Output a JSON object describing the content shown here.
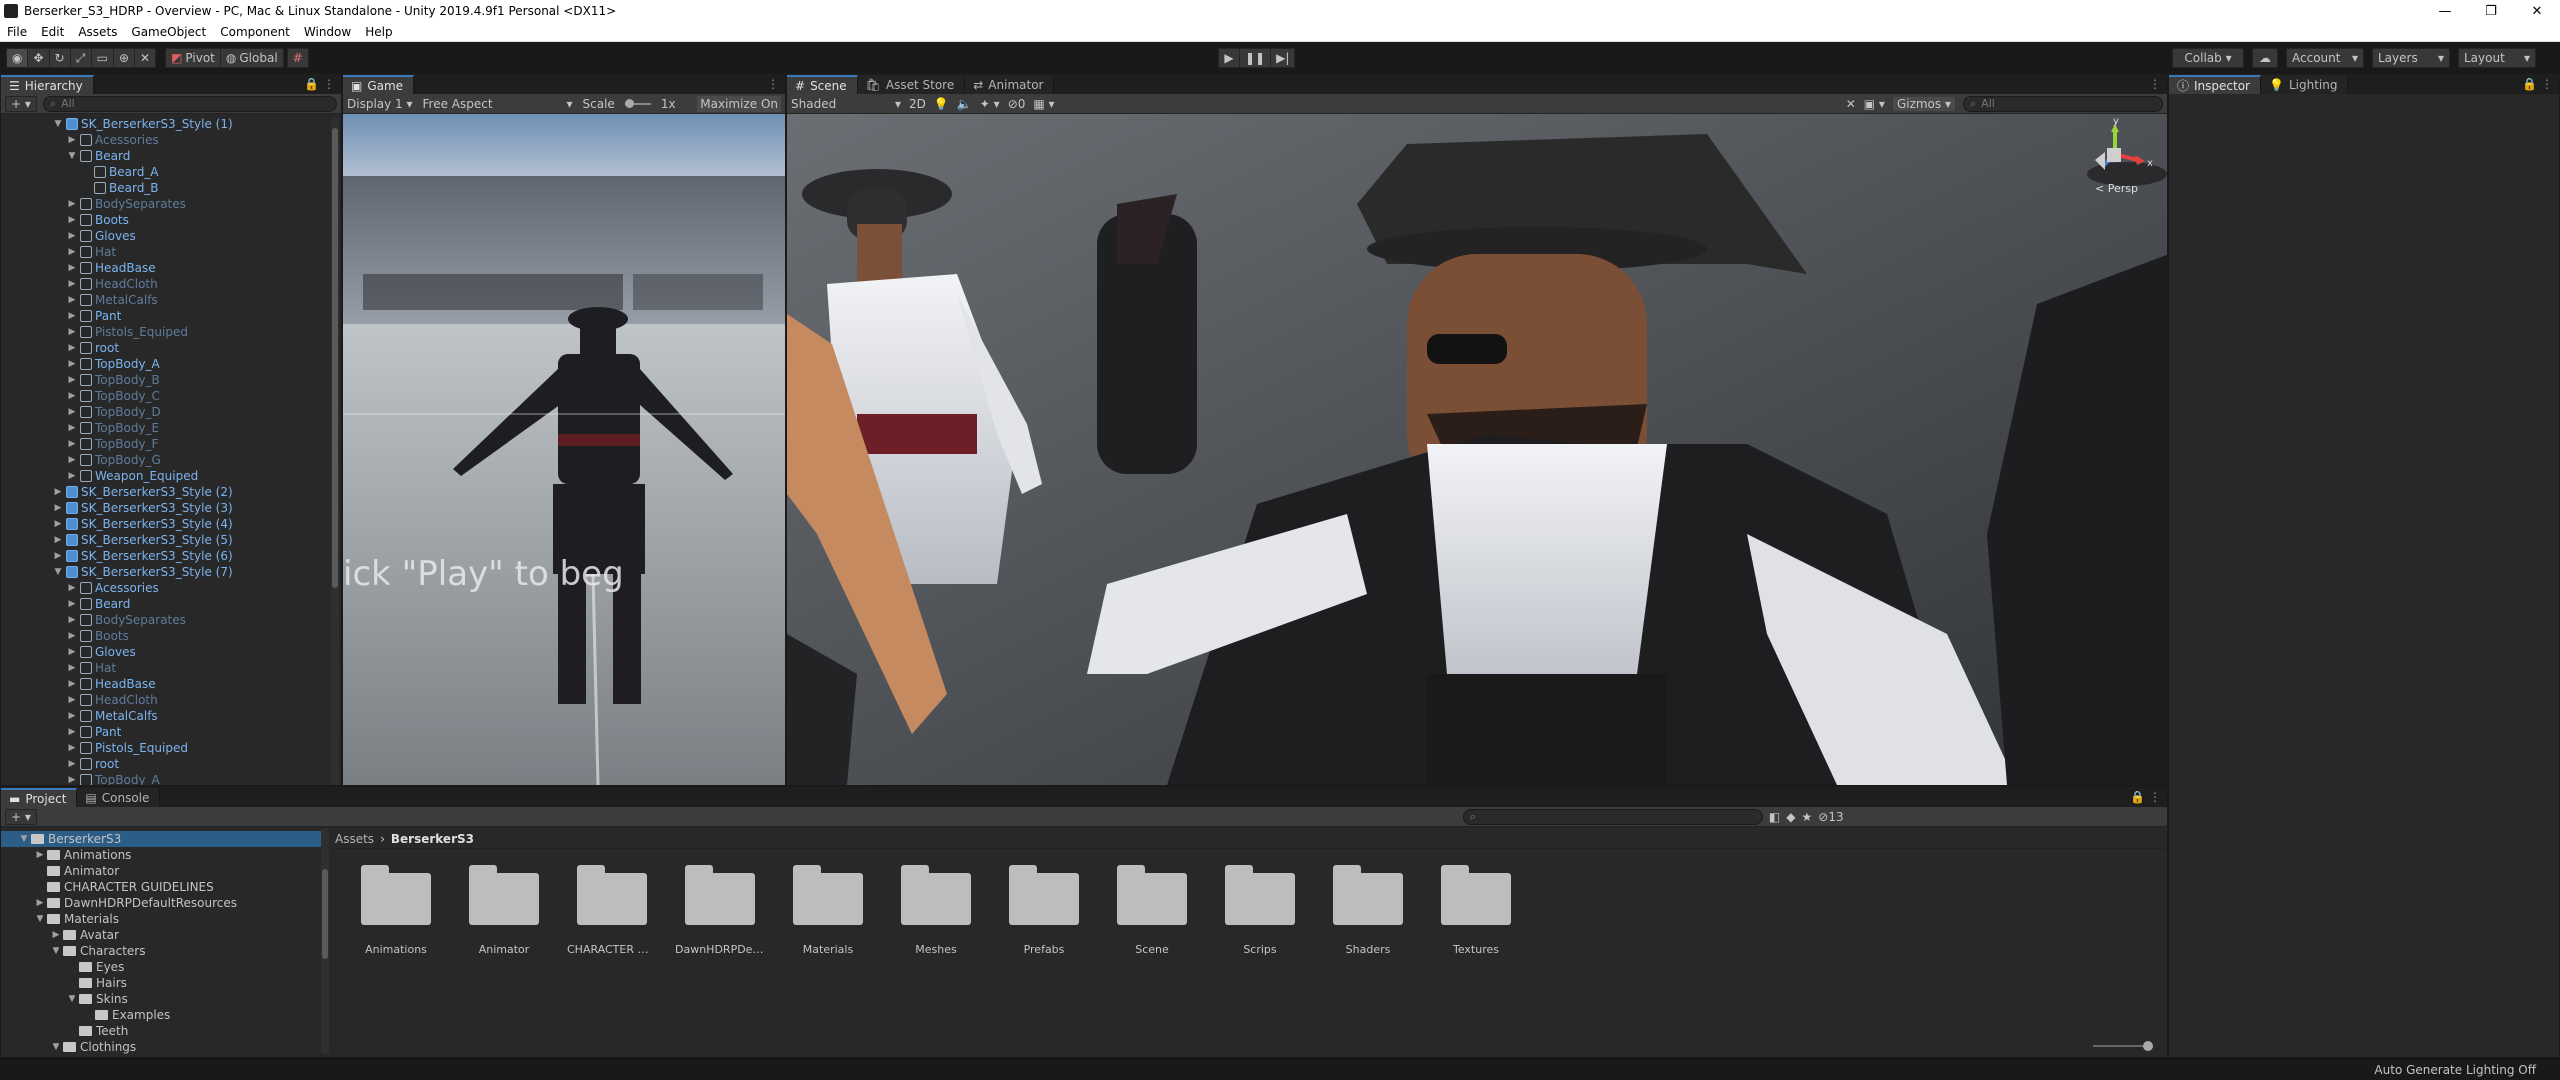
{
  "window": {
    "title": "Berserker_S3_HDRP - Overview - PC, Mac & Linux Standalone - Unity 2019.4.9f1 Personal <DX11>",
    "buttons": {
      "minimize": "—",
      "maximize": "❐",
      "close": "✕"
    }
  },
  "menu": [
    "File",
    "Edit",
    "Assets",
    "GameObject",
    "Component",
    "Window",
    "Help"
  ],
  "toolbar": {
    "pivot_label": "Pivot",
    "global_label": "Global",
    "collab_label": "Collab ▾",
    "account_label": "Account",
    "layers_label": "Layers",
    "layout_label": "Layout"
  },
  "hierarchy": {
    "tab_label": "Hierarchy",
    "search_placeholder": "All",
    "rows": [
      {
        "label": "SK_BerserkerS3_Style (1)",
        "indent": 1,
        "arrow": "▼",
        "kind": "root"
      },
      {
        "label": "Acessories",
        "indent": 2,
        "arrow": "▶",
        "kind": "dim"
      },
      {
        "label": "Beard",
        "indent": 2,
        "arrow": "▼",
        "kind": "prefab"
      },
      {
        "label": "Beard_A",
        "indent": 3,
        "arrow": "",
        "kind": "prefab"
      },
      {
        "label": "Beard_B",
        "indent": 3,
        "arrow": "",
        "kind": "prefab"
      },
      {
        "label": "BodySeparates",
        "indent": 2,
        "arrow": "▶",
        "kind": "dim"
      },
      {
        "label": "Boots",
        "indent": 2,
        "arrow": "▶",
        "kind": "prefab"
      },
      {
        "label": "Gloves",
        "indent": 2,
        "arrow": "▶",
        "kind": "prefab"
      },
      {
        "label": "Hat",
        "indent": 2,
        "arrow": "▶",
        "kind": "dim"
      },
      {
        "label": "HeadBase",
        "indent": 2,
        "arrow": "▶",
        "kind": "prefab"
      },
      {
        "label": "HeadCloth",
        "indent": 2,
        "arrow": "▶",
        "kind": "dim"
      },
      {
        "label": "MetalCalfs",
        "indent": 2,
        "arrow": "▶",
        "kind": "dim"
      },
      {
        "label": "Pant",
        "indent": 2,
        "arrow": "▶",
        "kind": "prefab"
      },
      {
        "label": "Pistols_Equiped",
        "indent": 2,
        "arrow": "▶",
        "kind": "dim"
      },
      {
        "label": "root",
        "indent": 2,
        "arrow": "▶",
        "kind": "prefab"
      },
      {
        "label": "TopBody_A",
        "indent": 2,
        "arrow": "▶",
        "kind": "prefab"
      },
      {
        "label": "TopBody_B",
        "indent": 2,
        "arrow": "▶",
        "kind": "dim"
      },
      {
        "label": "TopBody_C",
        "indent": 2,
        "arrow": "▶",
        "kind": "dim"
      },
      {
        "label": "TopBody_D",
        "indent": 2,
        "arrow": "▶",
        "kind": "dim"
      },
      {
        "label": "TopBody_E",
        "indent": 2,
        "arrow": "▶",
        "kind": "dim"
      },
      {
        "label": "TopBody_F",
        "indent": 2,
        "arrow": "▶",
        "kind": "dim"
      },
      {
        "label": "TopBody_G",
        "indent": 2,
        "arrow": "▶",
        "kind": "dim"
      },
      {
        "label": "Weapon_Equiped",
        "indent": 2,
        "arrow": "▶",
        "kind": "prefab"
      },
      {
        "label": "SK_BerserkerS3_Style (2)",
        "indent": 1,
        "arrow": "▶",
        "kind": "root"
      },
      {
        "label": "SK_BerserkerS3_Style (3)",
        "indent": 1,
        "arrow": "▶",
        "kind": "root"
      },
      {
        "label": "SK_BerserkerS3_Style (4)",
        "indent": 1,
        "arrow": "▶",
        "kind": "root"
      },
      {
        "label": "SK_BerserkerS3_Style (5)",
        "indent": 1,
        "arrow": "▶",
        "kind": "root"
      },
      {
        "label": "SK_BerserkerS3_Style (6)",
        "indent": 1,
        "arrow": "▶",
        "kind": "root"
      },
      {
        "label": "SK_BerserkerS3_Style (7)",
        "indent": 1,
        "arrow": "▼",
        "kind": "root"
      },
      {
        "label": "Acessories",
        "indent": 2,
        "arrow": "▶",
        "kind": "prefab"
      },
      {
        "label": "Beard",
        "indent": 2,
        "arrow": "▶",
        "kind": "prefab"
      },
      {
        "label": "BodySeparates",
        "indent": 2,
        "arrow": "▶",
        "kind": "dim"
      },
      {
        "label": "Boots",
        "indent": 2,
        "arrow": "▶",
        "kind": "dim"
      },
      {
        "label": "Gloves",
        "indent": 2,
        "arrow": "▶",
        "kind": "prefab"
      },
      {
        "label": "Hat",
        "indent": 2,
        "arrow": "▶",
        "kind": "dim"
      },
      {
        "label": "HeadBase",
        "indent": 2,
        "arrow": "▶",
        "kind": "prefab"
      },
      {
        "label": "HeadCloth",
        "indent": 2,
        "arrow": "▶",
        "kind": "dim"
      },
      {
        "label": "MetalCalfs",
        "indent": 2,
        "arrow": "▶",
        "kind": "prefab"
      },
      {
        "label": "Pant",
        "indent": 2,
        "arrow": "▶",
        "kind": "prefab"
      },
      {
        "label": "Pistols_Equiped",
        "indent": 2,
        "arrow": "▶",
        "kind": "prefab"
      },
      {
        "label": "root",
        "indent": 2,
        "arrow": "▶",
        "kind": "prefab"
      },
      {
        "label": "TopBody_A",
        "indent": 2,
        "arrow": "▶",
        "kind": "dim"
      }
    ]
  },
  "game": {
    "tab_label": "Game",
    "display_label": "Display 1",
    "aspect_label": "Free Aspect",
    "scale_label": "Scale",
    "scale_value": "1x",
    "maximize_label": "Maximize On",
    "overlay_text": "ick \"Play\" to beg"
  },
  "scene": {
    "tabs": [
      "Scene",
      "Asset Store",
      "Animator"
    ],
    "shading_label": "Shaded",
    "mode_2d_label": "2D",
    "hidden_count": "0",
    "gizmos_label": "Gizmos",
    "search_placeholder": "All",
    "persp_label": "< Persp",
    "axis_y": "y",
    "axis_x": "x"
  },
  "inspector": {
    "tabs": [
      "Inspector",
      "Lighting"
    ]
  },
  "project": {
    "tabs": [
      "Project",
      "Console"
    ],
    "breadcrumb": [
      "Assets",
      "BerserkerS3"
    ],
    "hidden_count": "13",
    "tree": [
      {
        "label": "BerserkerS3",
        "indent": 0,
        "arrow": "▼"
      },
      {
        "label": "Animations",
        "indent": 1,
        "arrow": "▶"
      },
      {
        "label": "Animator",
        "indent": 1,
        "arrow": ""
      },
      {
        "label": "CHARACTER GUIDELINES",
        "indent": 1,
        "arrow": ""
      },
      {
        "label": "DawnHDRPDefaultResources",
        "indent": 1,
        "arrow": "▶"
      },
      {
        "label": "Materials",
        "indent": 1,
        "arrow": "▼"
      },
      {
        "label": "Avatar",
        "indent": 2,
        "arrow": "▶"
      },
      {
        "label": "Characters",
        "indent": 2,
        "arrow": "▼"
      },
      {
        "label": "Eyes",
        "indent": 3,
        "arrow": ""
      },
      {
        "label": "Hairs",
        "indent": 3,
        "arrow": ""
      },
      {
        "label": "Skins",
        "indent": 3,
        "arrow": "▼"
      },
      {
        "label": "Examples",
        "indent": 4,
        "arrow": ""
      },
      {
        "label": "Teeth",
        "indent": 3,
        "arrow": ""
      },
      {
        "label": "Clothings",
        "indent": 2,
        "arrow": "▼"
      }
    ],
    "folders": [
      "Animations",
      "Animator",
      "CHARACTER GUI...",
      "DawnHDRPDefaul...",
      "Materials",
      "Meshes",
      "Prefabs",
      "Scene",
      "Scrips",
      "Shaders",
      "Textures"
    ]
  },
  "status": {
    "text": "Auto Generate Lighting Off"
  }
}
